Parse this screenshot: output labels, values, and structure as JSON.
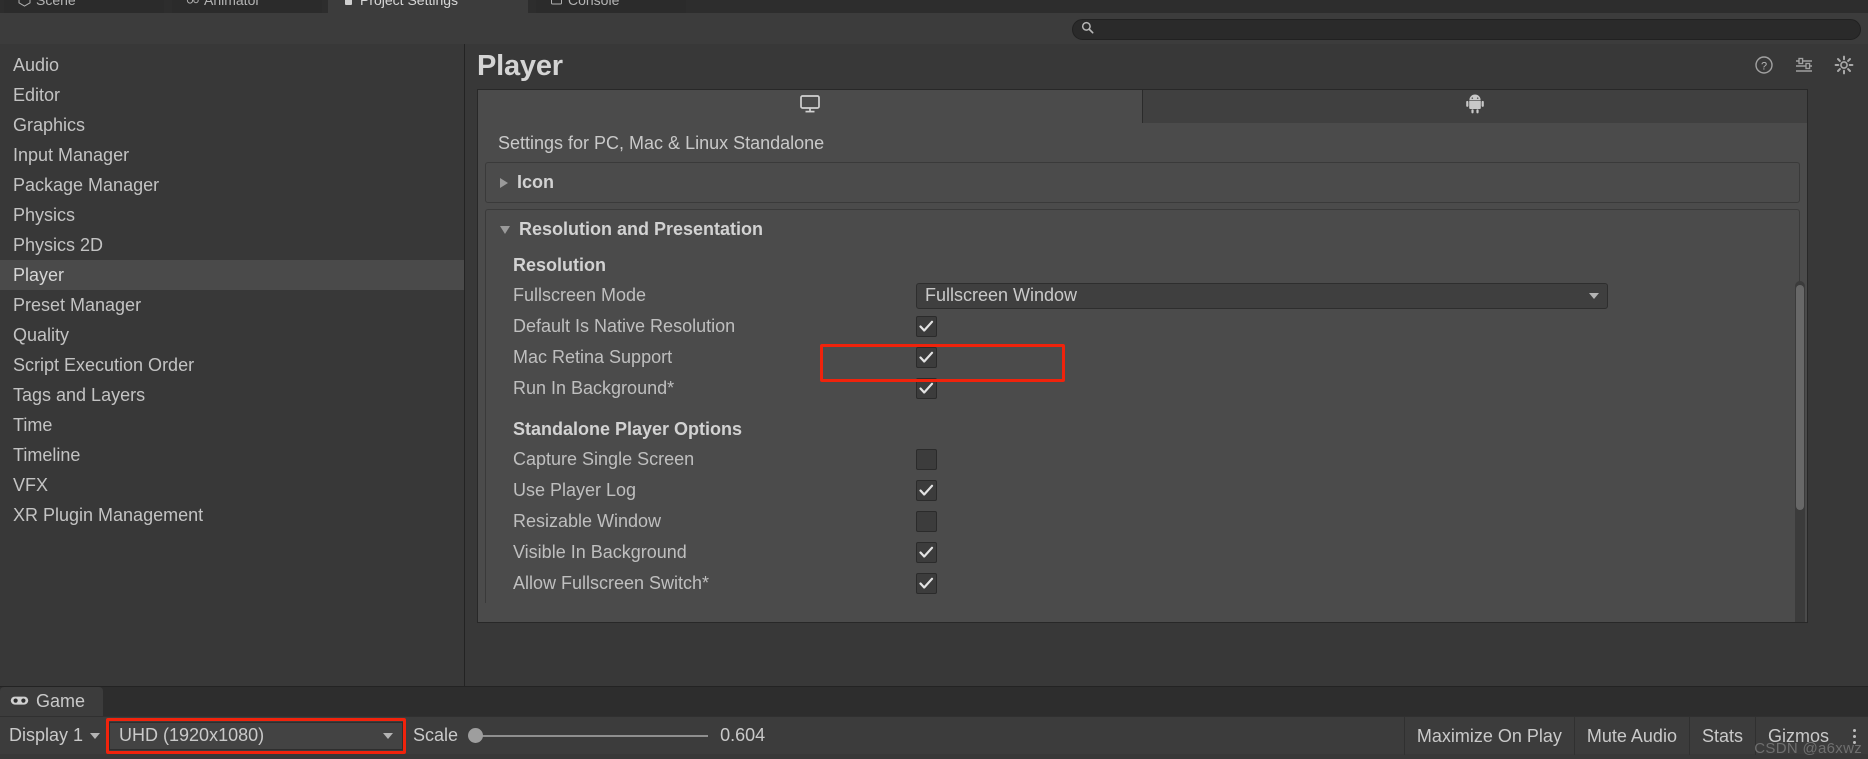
{
  "window": {
    "editor_tabs": [
      {
        "label": "Scene",
        "icon": "scene-icon",
        "active": false
      },
      {
        "label": "Animator",
        "icon": "animator-icon",
        "active": false
      },
      {
        "label": "Project Settings",
        "icon": "settings-icon",
        "active": true
      },
      {
        "label": "Console",
        "icon": "console-icon",
        "active": false
      }
    ]
  },
  "search": {
    "value": "",
    "placeholder": "",
    "icon": "search-icon"
  },
  "sidebar": {
    "items": [
      {
        "label": "Audio",
        "selected": false
      },
      {
        "label": "Editor",
        "selected": false
      },
      {
        "label": "Graphics",
        "selected": false
      },
      {
        "label": "Input Manager",
        "selected": false
      },
      {
        "label": "Package Manager",
        "selected": false
      },
      {
        "label": "Physics",
        "selected": false
      },
      {
        "label": "Physics 2D",
        "selected": false
      },
      {
        "label": "Player",
        "selected": true
      },
      {
        "label": "Preset Manager",
        "selected": false
      },
      {
        "label": "Quality",
        "selected": false
      },
      {
        "label": "Script Execution Order",
        "selected": false
      },
      {
        "label": "Tags and Layers",
        "selected": false
      },
      {
        "label": "Time",
        "selected": false
      },
      {
        "label": "Timeline",
        "selected": false
      },
      {
        "label": "VFX",
        "selected": false
      },
      {
        "label": "XR Plugin Management",
        "selected": false
      }
    ]
  },
  "content": {
    "title": "Player",
    "header_icons": [
      {
        "name": "help-icon"
      },
      {
        "name": "preset-icon"
      },
      {
        "name": "gear-icon"
      }
    ],
    "platform_tabs": [
      {
        "icon": "standalone-monitor-icon",
        "active": true
      },
      {
        "icon": "android-robot-icon",
        "active": false
      }
    ],
    "subtitle": "Settings for PC, Mac & Linux Standalone",
    "icon_section": {
      "label": "Icon",
      "expanded": false
    },
    "resolution_section": {
      "label": "Resolution and Presentation",
      "expanded": true,
      "groups": [
        {
          "label": "Resolution",
          "rows": [
            {
              "label": "Fullscreen Mode",
              "type": "dropdown",
              "value": "Fullscreen Window",
              "highlighted": true
            },
            {
              "label": "Default Is Native Resolution",
              "type": "checkbox",
              "checked": true
            },
            {
              "label": "Mac Retina Support",
              "type": "checkbox",
              "checked": true
            },
            {
              "label": "Run In Background*",
              "type": "checkbox",
              "checked": true
            }
          ]
        },
        {
          "label": "Standalone Player Options",
          "rows": [
            {
              "label": "Capture Single Screen",
              "type": "checkbox",
              "checked": false
            },
            {
              "label": "Use Player Log",
              "type": "checkbox",
              "checked": true
            },
            {
              "label": "Resizable Window",
              "type": "checkbox",
              "checked": false
            },
            {
              "label": "Visible In Background",
              "type": "checkbox",
              "checked": true
            },
            {
              "label": "Allow Fullscreen Switch*",
              "type": "checkbox",
              "checked": true
            }
          ]
        }
      ]
    }
  },
  "game_panel": {
    "tab_label": "Game",
    "tab_icon": "game-controller-icon",
    "display_dropdown": "Display 1",
    "resolution_dropdown": "UHD (1920x1080)",
    "resolution_highlighted": true,
    "scale_label": "Scale",
    "scale_value": "0.604",
    "buttons": [
      {
        "label": "Maximize On Play"
      },
      {
        "label": "Mute Audio"
      },
      {
        "label": "Stats"
      },
      {
        "label": "Gizmos"
      }
    ],
    "kebab_icon": "more-options-icon"
  },
  "watermark": "CSDN @a6xwz",
  "colors": {
    "background": "#383838",
    "panel": "#4b4b4b",
    "selection": "#4a4a4a",
    "highlight_red": "#f0230c",
    "text": "#c3c3c3"
  }
}
